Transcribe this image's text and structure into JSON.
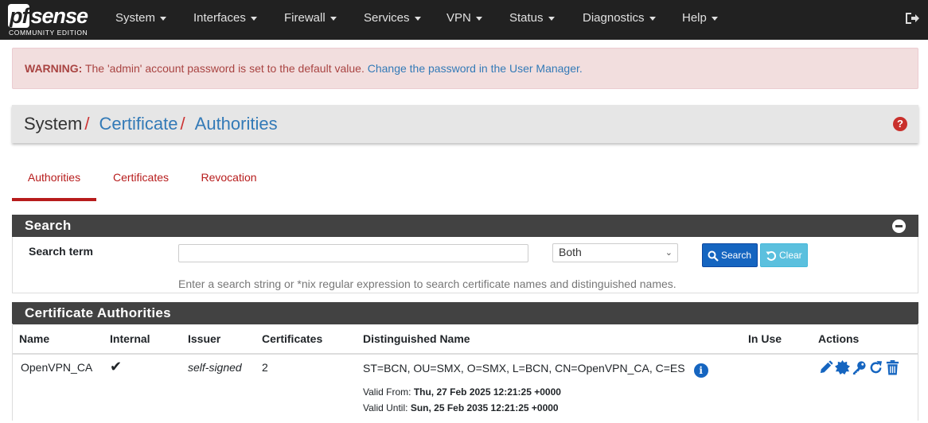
{
  "nav": {
    "logo": {
      "brand_pf": "pf",
      "brand_sense": "sense",
      "edition": "COMMUNITY EDITION"
    },
    "menu": [
      "System",
      "Interfaces",
      "Firewall",
      "Services",
      "VPN",
      "Status",
      "Diagnostics",
      "Help"
    ],
    "logout_icon": "sign-out-icon"
  },
  "alert": {
    "prefix": "WARNING:",
    "message": " The 'admin' account password is set to the default value. ",
    "link": "Change the password in the User Manager."
  },
  "breadcrumb": {
    "root": "System",
    "level1": "Certificate",
    "level2": "Authorities",
    "sep": "/"
  },
  "tabs": [
    "Authorities",
    "Certificates",
    "Revocation"
  ],
  "search_panel": {
    "title": "Search",
    "label": "Search term",
    "input_value": "",
    "select_value": "Both",
    "search_button": "Search",
    "clear_button": "Clear",
    "help": "Enter a search string or *nix regular expression to search certificate names and distinguished names."
  },
  "ca_panel": {
    "title": "Certificate Authorities",
    "columns": [
      "Name",
      "Internal",
      "Issuer",
      "Certificates",
      "Distinguished Name",
      "In Use",
      "Actions"
    ],
    "rows": [
      {
        "name": "OpenVPN_CA",
        "internal": "✔",
        "issuer": "self-signed",
        "certificates": "2",
        "dn": "ST=BCN, OU=SMX, O=SMX, L=BCN, CN=OpenVPN_CA, C=ES",
        "valid_from_label": "Valid From:",
        "valid_from": "Thu, 27 Feb 2025 12:21:25 +0000",
        "valid_until_label": "Valid Until:",
        "valid_until": "Sun, 25 Feb 2035 12:21:25 +0000",
        "in_use": ""
      }
    ]
  },
  "colors": {
    "navbar": "#212121",
    "accent_red": "#b71c1c",
    "link_blue": "#337ab7",
    "primary": "#1565c0",
    "info": "#5bc0de",
    "panel_head": "#424242"
  }
}
